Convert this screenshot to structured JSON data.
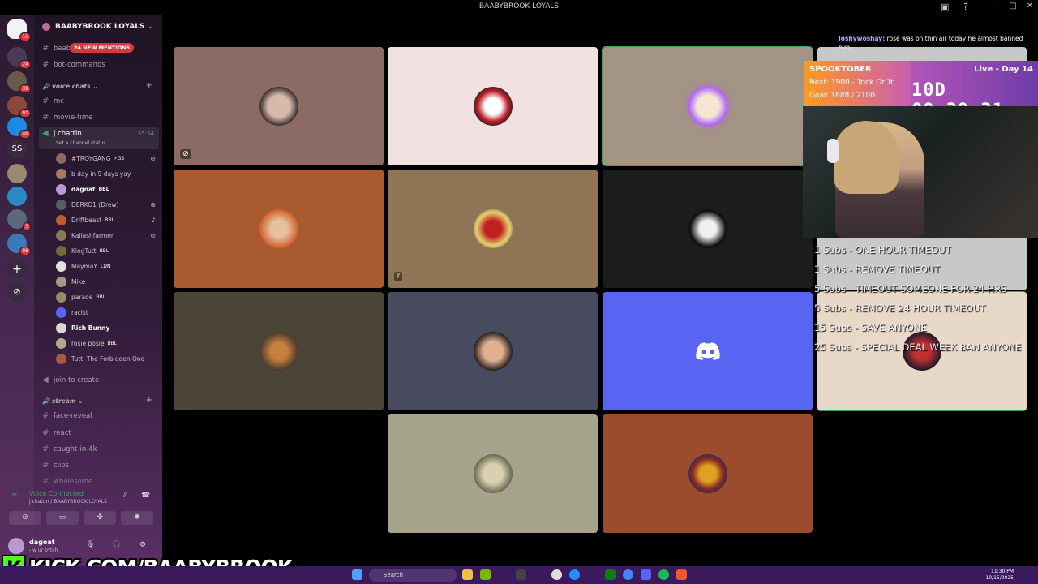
{
  "window": {
    "title": "BAABYBROOK LOYALS"
  },
  "server_badges": {
    "home": "16",
    "s1": "24",
    "s2": "39",
    "s3": "91",
    "s4": "49",
    "ss": "SS",
    "s6": "3",
    "s7": "86"
  },
  "guild": {
    "name": "BAABYBROOK LOYALS",
    "mentions_pill": "24 NEW MENTIONS"
  },
  "channels": {
    "top": [
      {
        "name": "baabybrook"
      },
      {
        "name": "bot-commands"
      }
    ],
    "voice_category": "voice chats",
    "voice": [
      {
        "name": "mc"
      },
      {
        "name": "movie-time"
      }
    ],
    "active": {
      "name": "j chattin",
      "time": "55:54",
      "status": "Set a channel status"
    },
    "members": [
      {
        "name": "#TROYGANG",
        "tag": "⚡GS"
      },
      {
        "name": "b day in 9 days yay",
        "tag": ""
      },
      {
        "name": "dagoat",
        "tag": "BBL"
      },
      {
        "name": "DERKO1 (Drew)",
        "tag": ""
      },
      {
        "name": "Driftbeast",
        "tag": "BBL"
      },
      {
        "name": "Kailashfarmer",
        "tag": ""
      },
      {
        "name": "KingTutt",
        "tag": "BBL"
      },
      {
        "name": "MaymaY",
        "tag": "LDN"
      },
      {
        "name": "Mike",
        "tag": ""
      },
      {
        "name": "parade",
        "tag": "BBL"
      },
      {
        "name": "racist",
        "tag": ""
      },
      {
        "name": "Rich Bunny",
        "tag": ""
      },
      {
        "name": "rosie posie",
        "tag": "BBL"
      },
      {
        "name": "Tutt, The Forbidden One",
        "tag": ""
      }
    ],
    "join_to_create": "join to create",
    "stream_category": "stream",
    "stream": [
      {
        "name": "face-reveal"
      },
      {
        "name": "react"
      },
      {
        "name": "caught-in-4k"
      },
      {
        "name": "clips"
      },
      {
        "name": "wholesome"
      }
    ]
  },
  "voice_status": {
    "title": "Voice Connected",
    "subtitle": "j chattin / BAABYBROOK LOYALS"
  },
  "user": {
    "name": "dagoat",
    "status": "- w ur b*tch"
  },
  "kick": {
    "letter": "K",
    "url": "KICK.COM/BAABYBROOK"
  },
  "overlay": {
    "chat_user": "Joshywoshay:",
    "chat_msg": "rose was on thin air today he almost banned him",
    "event": "SPOOKTOBER",
    "next": "Next: 1900 - Trick Or Tr",
    "goal": "Goal: 1888 / 2100",
    "live": "Live - Day 14",
    "timer": "10D 00:39:21",
    "subs": [
      "1 Subs - ONE HOUR TIMEOUT",
      "1 Subs - REMOVE TIMEOUT",
      "5 Subs - TIMEOUT SOMEONE FOR 24 HRS",
      "5 Subs - REMOVE 24 HOUR TIMEOUT",
      "15 Subs - SAVE ANYONE",
      "25 Subs - SPECIAL DEAL WEEK BAN ANYONE"
    ]
  },
  "tiles_colors": {
    "t1": "#8c6b64",
    "t2": "#f1e1e1",
    "t3": "#a39485",
    "t4": "#a95a30",
    "t5": "#8f7556",
    "t6": "#1b1d1a",
    "t7": "#4a4536",
    "t8": "#474b5d",
    "t9": "#5865f2",
    "t10": "#a6a38c",
    "t11": "#9a4c2c"
  },
  "taskbar": {
    "search": "Search",
    "time": "11:30 PM",
    "date": "10/15/2025"
  }
}
